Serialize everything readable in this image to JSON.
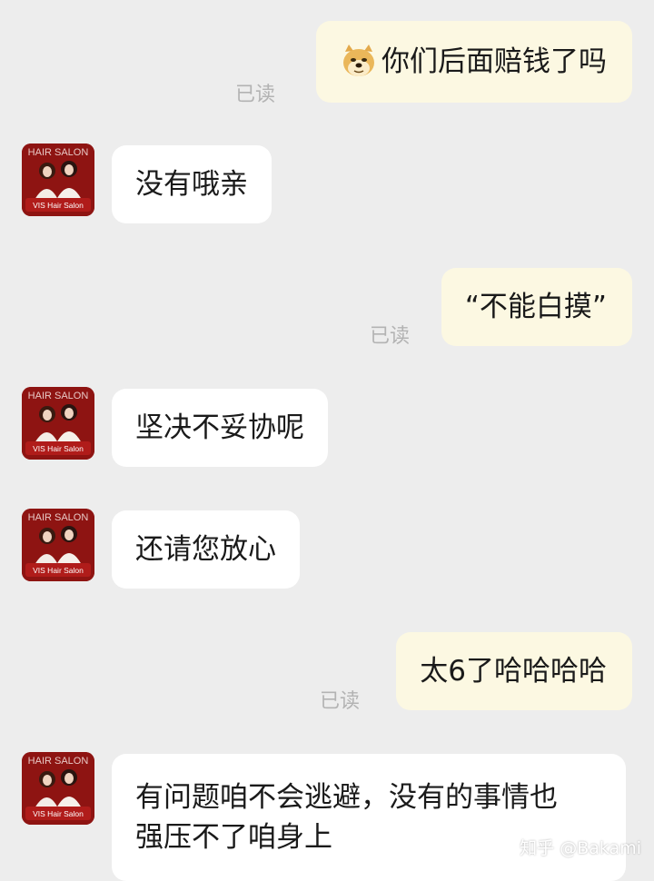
{
  "conversation": {
    "messages": [
      {
        "side": "out",
        "text": "你们后面赔钱了吗",
        "read": "已读",
        "emoji": "doge"
      },
      {
        "side": "in",
        "text": "没有哦亲"
      },
      {
        "side": "out",
        "text": "“不能白摸”",
        "read": "已读"
      },
      {
        "side": "in",
        "text": "坚决不妥协呢"
      },
      {
        "side": "in",
        "text": "还请您放心"
      },
      {
        "side": "out",
        "text": "太6了哈哈哈哈",
        "read": "已读"
      },
      {
        "side": "in",
        "text": "有问题咱不会逃避，没有的事情也强压不了咱身上",
        "line1": "有问题咱不会逃避，没有的事情也",
        "line2": "强压不了咱身上"
      }
    ]
  },
  "avatar": {
    "label": "VIS Hair Salon",
    "top_text": "HAIR SALON",
    "color": "#8e1412"
  },
  "watermark": "知乎 @Bakami",
  "colors": {
    "background": "#ededed",
    "outgoing_bubble": "#fcf8e2",
    "incoming_bubble": "#ffffff",
    "read_text": "#b3b3b3"
  }
}
